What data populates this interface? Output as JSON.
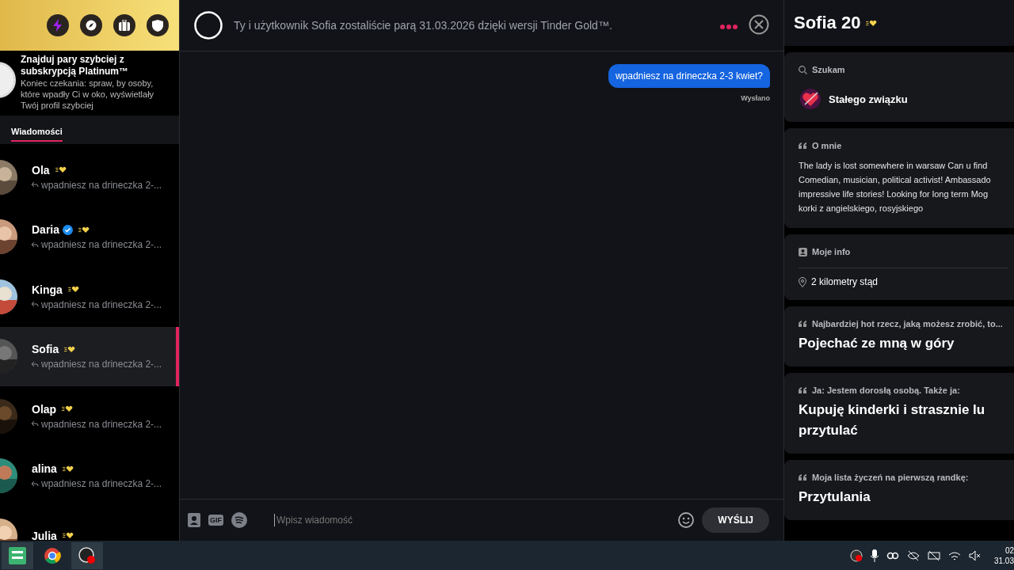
{
  "sidebar": {
    "promo": {
      "title": "Znajduj pary szybciej z subskrypcją Platinum™",
      "text": "Koniec czekania: spraw, by osoby, które wpadły Ci w oko, wyświetlały Twój profil szybciej"
    },
    "tabs": [
      {
        "label": "Wiadomości",
        "selected": true
      }
    ],
    "matches": [
      {
        "name": "Ola",
        "verified": false,
        "preview": "wpadniesz na drineczka 2-...",
        "selected": false
      },
      {
        "name": "Daria",
        "verified": true,
        "preview": "wpadniesz na drineczka 2-...",
        "selected": false
      },
      {
        "name": "Kinga",
        "verified": false,
        "preview": "wpadniesz na drineczka 2-...",
        "selected": false
      },
      {
        "name": "Sofia",
        "verified": false,
        "preview": "wpadniesz na drineczka 2-...",
        "selected": true
      },
      {
        "name": "Olap",
        "verified": false,
        "preview": "wpadniesz na drineczka 2-...",
        "selected": false
      },
      {
        "name": "alina",
        "verified": false,
        "preview": "wpadniesz na drineczka 2-...",
        "selected": false
      },
      {
        "name": "Julia",
        "verified": false,
        "selected": false
      }
    ]
  },
  "chat": {
    "header": "Ty i użytkownik Sofia zostaliście parą 31.03.2026 dzięki wersji Tinder Gold™.",
    "messages": [
      {
        "text": "wpadniesz na drineczka 2-3 kwiet?",
        "status": "Wysłano"
      }
    ],
    "input": {
      "gif": "GIF",
      "placeholder": "Wpisz wiadomość",
      "send": "WYŚLIJ"
    }
  },
  "profile": {
    "name": "Sofia 20",
    "sections": [
      {
        "kind": "looking",
        "label": "Szukam",
        "lines": [
          "Stałego związku"
        ]
      },
      {
        "kind": "about",
        "label": "O mnie",
        "lines": [
          "The lady is lost somewhere in warsaw Can u find",
          "Comedian, musician, political activist! Ambassado",
          "impressive life stories! Looking for long term Mog",
          "korki z angielskiego, rosyjskiego"
        ]
      },
      {
        "kind": "info",
        "label": "Moje info",
        "lines": [
          "2 kilometry stąd"
        ]
      },
      {
        "kind": "prompt",
        "label": "Najbardziej hot rzecz, jaką możesz zrobić, to...",
        "lines": [
          "Pojechać ze mną w góry"
        ]
      },
      {
        "kind": "prompt",
        "label": "Ja: Jestem dorosłą osobą. Także ja:",
        "lines": [
          "Kupuję kinderki i strasznie lu",
          "przytulać"
        ]
      },
      {
        "kind": "prompt",
        "label": "Moja lista życzeń na pierwszą randkę:",
        "lines": [
          "Przytulania"
        ]
      }
    ]
  },
  "taskbar": {
    "clock": [
      "02",
      "31.03"
    ]
  }
}
